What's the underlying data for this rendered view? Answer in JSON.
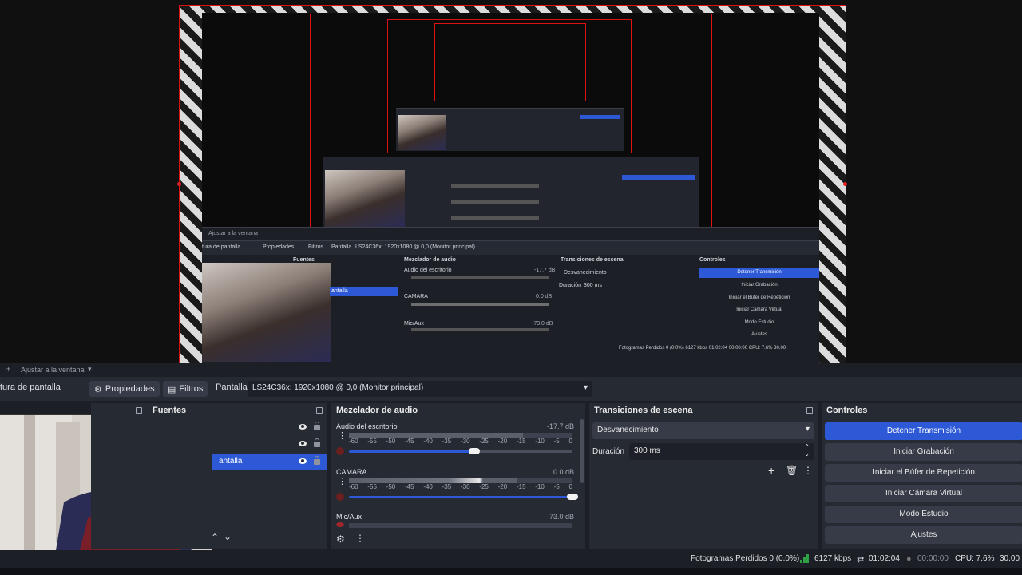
{
  "preview": {
    "fit_label": "Ajustar a la ventana",
    "nested": {
      "props_label": "Propiedades",
      "filters_label": "Filtros",
      "display_label": "Pantalla",
      "display_value": "LS24C36x: 1920x1080 @ 0,0 (Monitor principal)",
      "sources_title": "Fuentes",
      "mixer_title": "Mezclador de audio",
      "transitions_title": "Transiciones de escena",
      "controls_title": "Controles",
      "mixer_channels": [
        {
          "name": "Audio del escritorio",
          "db": "-17.7 dB"
        },
        {
          "name": "CAMARA",
          "db": "0.0 dB"
        },
        {
          "name": "Mic/Aux",
          "db": "-73.0 dB"
        }
      ],
      "transition_value": "Desvanecimiento",
      "duration_label": "Duración",
      "duration_value": "300 ms",
      "controls": [
        "Detener Transmisión",
        "Iniciar Grabación",
        "Iniciar el Búfer de Repetición",
        "Iniciar Cámara Virtual",
        "Modo Estudio",
        "Ajustes"
      ],
      "sources_selected": "Pantalla",
      "capture_label": "tura de pantalla",
      "status": "Fotogramas Perdidos 0 (0.0%)   6127 kbps   01:02:04   00:00:00   CPU: 7.6%   30.00"
    }
  },
  "fit_bar": {
    "label": "Ajustar a la ventana"
  },
  "props_bar": {
    "capture_label": "tura de pantalla",
    "properties_label": "Propiedades",
    "filters_label": "Filtros",
    "display_label": "Pantalla",
    "display_value": "LS24C36x: 1920x1080 @ 0,0 (Monitor principal)"
  },
  "sources": {
    "title": "Fuentes",
    "selected_item": "antalla"
  },
  "mixer": {
    "title": "Mezclador de audio",
    "ticks": [
      "-60",
      "-55",
      "-50",
      "-45",
      "-40",
      "-35",
      "-30",
      "-25",
      "-20",
      "-15",
      "-10",
      "-5",
      "0"
    ],
    "channels": [
      {
        "name": "Audio del escritorio",
        "db": "-17.7 dB",
        "level": 0.78,
        "volume": 0.56
      },
      {
        "name": "CAMARA",
        "db": "0.0 dB",
        "level": 0.75,
        "volume": 1.0
      },
      {
        "name": "Mic/Aux",
        "db": "-73.0 dB",
        "level": 0.0,
        "volume": 0.0
      }
    ]
  },
  "transitions": {
    "title": "Transiciones de escena",
    "value": "Desvanecimiento",
    "duration_label": "Duración",
    "duration_value": "300 ms"
  },
  "controls": {
    "title": "Controles",
    "stop_stream": "Detener Transmisión",
    "start_recording": "Iniciar Grabación",
    "start_replay": "Iniciar el Búfer de Repetición",
    "start_vcam": "Iniciar Cámara Virtual",
    "studio_mode": "Modo Estudio",
    "settings": "Ajustes"
  },
  "status": {
    "dropped_frames": "Fotogramas Perdidos 0 (0.0%)",
    "bitrate": "6127 kbps",
    "stream_time": "01:02:04",
    "record_time": "00:00:00",
    "cpu": "CPU: 7.6%",
    "fps": "30.00"
  },
  "colors": {
    "accent": "#2d59d6",
    "panel": "#262a33",
    "background": "#1d1f26",
    "live": "#2ea043"
  }
}
